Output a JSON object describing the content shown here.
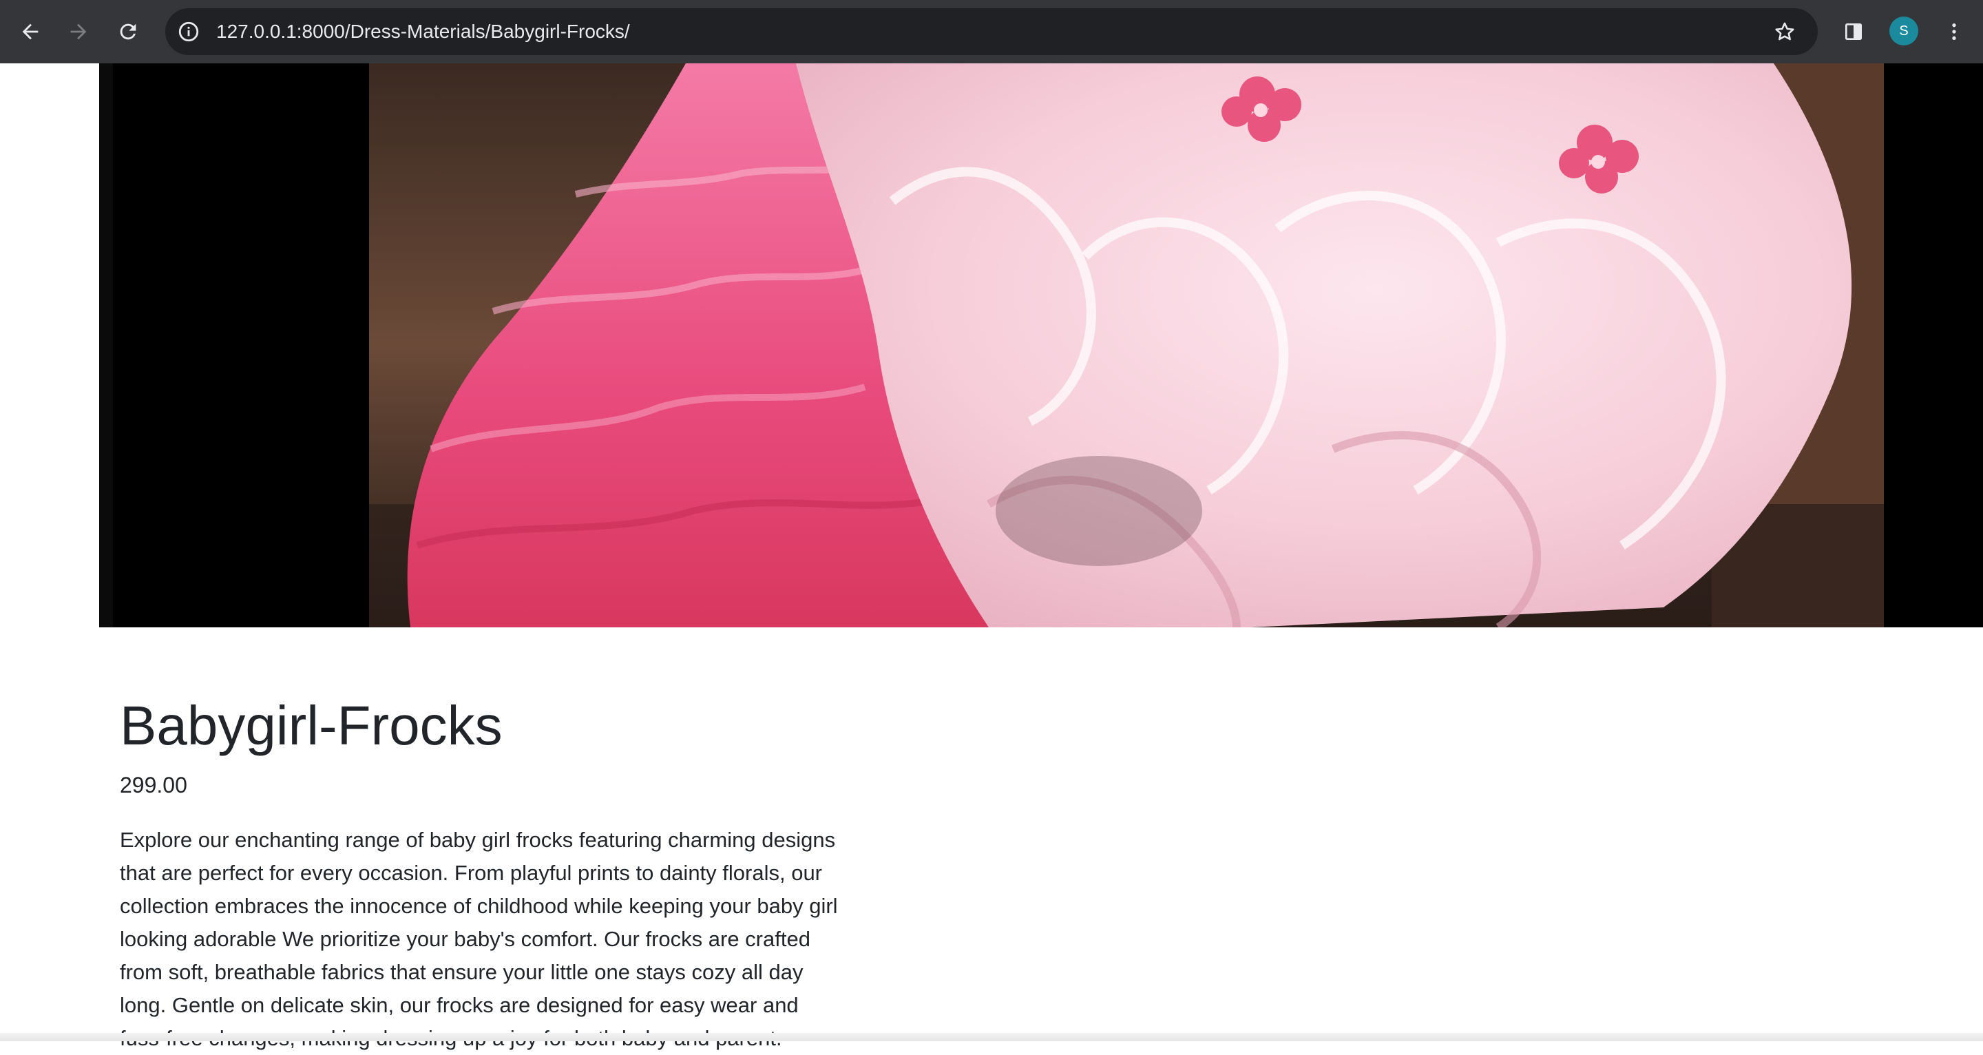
{
  "browser": {
    "url": "127.0.0.1:8000/Dress-Materials/Babygirl-Frocks/",
    "profile_initial": "S",
    "icons": {
      "back": "back-arrow-icon",
      "forward": "forward-arrow-icon",
      "reload": "reload-icon",
      "site_info": "info-icon",
      "bookmark": "star-icon",
      "side_panel": "side-panel-icon",
      "menu": "kebab-menu-icon"
    }
  },
  "product": {
    "title": "Babygirl-Frocks",
    "price": "299.00",
    "description": "Explore our enchanting range of baby girl frocks featuring charming designs that are perfect for every occasion. From playful prints to dainty florals, our collection embraces the innocence of childhood while keeping your baby girl looking adorable We prioritize your baby's comfort. Our frocks are crafted from soft, breathable fabrics that ensure your little one stays cozy all day long. Gentle on delicate skin, our frocks are designed for easy wear and fuss-free changes, making dressing up a joy for both baby and parent."
  },
  "colors": {
    "chrome_bg": "#35363a",
    "omnibox_bg": "#202124",
    "avatar": "#1a8a9c",
    "text": "#212529"
  }
}
